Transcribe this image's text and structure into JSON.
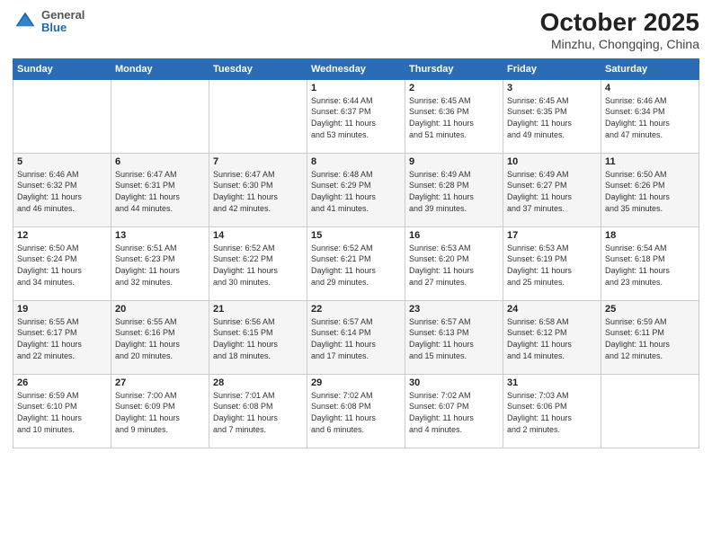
{
  "header": {
    "logo_general": "General",
    "logo_blue": "Blue",
    "month_title": "October 2025",
    "location": "Minzhu, Chongqing, China"
  },
  "weekdays": [
    "Sunday",
    "Monday",
    "Tuesday",
    "Wednesday",
    "Thursday",
    "Friday",
    "Saturday"
  ],
  "weeks": [
    [
      {
        "day": "",
        "info": ""
      },
      {
        "day": "",
        "info": ""
      },
      {
        "day": "",
        "info": ""
      },
      {
        "day": "1",
        "info": "Sunrise: 6:44 AM\nSunset: 6:37 PM\nDaylight: 11 hours\nand 53 minutes."
      },
      {
        "day": "2",
        "info": "Sunrise: 6:45 AM\nSunset: 6:36 PM\nDaylight: 11 hours\nand 51 minutes."
      },
      {
        "day": "3",
        "info": "Sunrise: 6:45 AM\nSunset: 6:35 PM\nDaylight: 11 hours\nand 49 minutes."
      },
      {
        "day": "4",
        "info": "Sunrise: 6:46 AM\nSunset: 6:34 PM\nDaylight: 11 hours\nand 47 minutes."
      }
    ],
    [
      {
        "day": "5",
        "info": "Sunrise: 6:46 AM\nSunset: 6:32 PM\nDaylight: 11 hours\nand 46 minutes."
      },
      {
        "day": "6",
        "info": "Sunrise: 6:47 AM\nSunset: 6:31 PM\nDaylight: 11 hours\nand 44 minutes."
      },
      {
        "day": "7",
        "info": "Sunrise: 6:47 AM\nSunset: 6:30 PM\nDaylight: 11 hours\nand 42 minutes."
      },
      {
        "day": "8",
        "info": "Sunrise: 6:48 AM\nSunset: 6:29 PM\nDaylight: 11 hours\nand 41 minutes."
      },
      {
        "day": "9",
        "info": "Sunrise: 6:49 AM\nSunset: 6:28 PM\nDaylight: 11 hours\nand 39 minutes."
      },
      {
        "day": "10",
        "info": "Sunrise: 6:49 AM\nSunset: 6:27 PM\nDaylight: 11 hours\nand 37 minutes."
      },
      {
        "day": "11",
        "info": "Sunrise: 6:50 AM\nSunset: 6:26 PM\nDaylight: 11 hours\nand 35 minutes."
      }
    ],
    [
      {
        "day": "12",
        "info": "Sunrise: 6:50 AM\nSunset: 6:24 PM\nDaylight: 11 hours\nand 34 minutes."
      },
      {
        "day": "13",
        "info": "Sunrise: 6:51 AM\nSunset: 6:23 PM\nDaylight: 11 hours\nand 32 minutes."
      },
      {
        "day": "14",
        "info": "Sunrise: 6:52 AM\nSunset: 6:22 PM\nDaylight: 11 hours\nand 30 minutes."
      },
      {
        "day": "15",
        "info": "Sunrise: 6:52 AM\nSunset: 6:21 PM\nDaylight: 11 hours\nand 29 minutes."
      },
      {
        "day": "16",
        "info": "Sunrise: 6:53 AM\nSunset: 6:20 PM\nDaylight: 11 hours\nand 27 minutes."
      },
      {
        "day": "17",
        "info": "Sunrise: 6:53 AM\nSunset: 6:19 PM\nDaylight: 11 hours\nand 25 minutes."
      },
      {
        "day": "18",
        "info": "Sunrise: 6:54 AM\nSunset: 6:18 PM\nDaylight: 11 hours\nand 23 minutes."
      }
    ],
    [
      {
        "day": "19",
        "info": "Sunrise: 6:55 AM\nSunset: 6:17 PM\nDaylight: 11 hours\nand 22 minutes."
      },
      {
        "day": "20",
        "info": "Sunrise: 6:55 AM\nSunset: 6:16 PM\nDaylight: 11 hours\nand 20 minutes."
      },
      {
        "day": "21",
        "info": "Sunrise: 6:56 AM\nSunset: 6:15 PM\nDaylight: 11 hours\nand 18 minutes."
      },
      {
        "day": "22",
        "info": "Sunrise: 6:57 AM\nSunset: 6:14 PM\nDaylight: 11 hours\nand 17 minutes."
      },
      {
        "day": "23",
        "info": "Sunrise: 6:57 AM\nSunset: 6:13 PM\nDaylight: 11 hours\nand 15 minutes."
      },
      {
        "day": "24",
        "info": "Sunrise: 6:58 AM\nSunset: 6:12 PM\nDaylight: 11 hours\nand 14 minutes."
      },
      {
        "day": "25",
        "info": "Sunrise: 6:59 AM\nSunset: 6:11 PM\nDaylight: 11 hours\nand 12 minutes."
      }
    ],
    [
      {
        "day": "26",
        "info": "Sunrise: 6:59 AM\nSunset: 6:10 PM\nDaylight: 11 hours\nand 10 minutes."
      },
      {
        "day": "27",
        "info": "Sunrise: 7:00 AM\nSunset: 6:09 PM\nDaylight: 11 hours\nand 9 minutes."
      },
      {
        "day": "28",
        "info": "Sunrise: 7:01 AM\nSunset: 6:08 PM\nDaylight: 11 hours\nand 7 minutes."
      },
      {
        "day": "29",
        "info": "Sunrise: 7:02 AM\nSunset: 6:08 PM\nDaylight: 11 hours\nand 6 minutes."
      },
      {
        "day": "30",
        "info": "Sunrise: 7:02 AM\nSunset: 6:07 PM\nDaylight: 11 hours\nand 4 minutes."
      },
      {
        "day": "31",
        "info": "Sunrise: 7:03 AM\nSunset: 6:06 PM\nDaylight: 11 hours\nand 2 minutes."
      },
      {
        "day": "",
        "info": ""
      }
    ]
  ]
}
